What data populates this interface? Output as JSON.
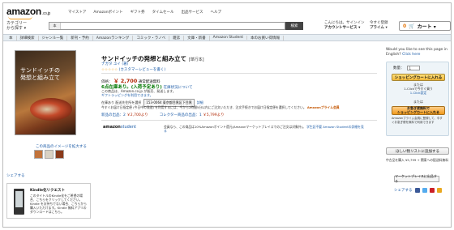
{
  "header": {
    "logo_main": "amazon",
    "logo_suffix": ".co.jp",
    "top_links": [
      "マイストア",
      "Amazonポイント",
      "ギフト券",
      "タイムセール",
      "出品サービス",
      "ヘルプ"
    ],
    "category_label": "カテゴリー\nから探す ▾",
    "search_category": "本",
    "search_value": "",
    "search_button": "検索",
    "account_line1": "こんにちは。サインイン",
    "account_line2": "アカウントサービス ▾",
    "prime_line1": "今すぐ登録",
    "prime_line2": "プライム ▾",
    "cart_count": "0",
    "cart_label": "カート ▾"
  },
  "catbar": [
    "本",
    "詳細検索",
    "ジャンル一覧",
    "新刊・予約",
    "Amazonランキング",
    "コミック・ラノベ",
    "雑誌",
    "文庫・新書",
    "Amazon Student",
    "本のお買い得情報"
  ],
  "product": {
    "cover_title": "サンドイッチの\n発想と組み立て",
    "title": "サンドイッチの発想と組み立て",
    "format": "[単行本]",
    "author": "ナガタ ユイ (著)",
    "stars": "☆☆☆☆☆",
    "reviews": "(カスタマーレビューを書く)",
    "price_label": "価格：",
    "price": "￥ 2,700",
    "price_note": "通常配送無料",
    "stock": "6点在庫あり。(入荷予定あり)",
    "stock_note": "在庫状況について",
    "seller": "この商品は、Amazon.co.jp が販売、発送します。",
    "gift": "ギフトラッピングを利用できます。",
    "delivery_label": "在庫あり 配送先住所を選択",
    "delivery_value": "153-0064 東京都目黒区下目黒",
    "delivery_link": "詳細",
    "info": "今すぐお届け日指定便 (今日中の発送) を利用するには、今から2時間5分以内にご注文いただき、注文手続きでお届け日指定便を選択してください。",
    "info_bold": "Amazonプライム会員",
    "new_label": "新品の出品：2",
    "new_price": "￥2,700より",
    "used_label": "コレクター商品の出品：1",
    "used_price": "￥5,799より"
  },
  "student": {
    "logo_a": "amazon",
    "logo_b": "student",
    "text": "会員なら、この商品は10%Amazonポイント還元(Amazonマーケットプレイスでのご注文は対象外)。",
    "link": "学生証不要 Amazon Studentの詳細を見る"
  },
  "left": {
    "zoom_link": "この商品のイメージを拡大する",
    "share": "シェアする",
    "kindle_title": "Kindle化リクエスト",
    "kindle_desc": "このタイトルのKindle化をご希望の場合、こちらをクリックしてください。Kindle をお持ちでない場合、こちらから購入いただけます。Kindle 無料アプリのダウンロードはこちら。"
  },
  "side": {
    "question": "Would you like to see this page in English?",
    "question_link": "Click here",
    "qty_label": "数量：",
    "qty_value": "1",
    "add_cart": "ショッピングカートに入れる",
    "or1": "または",
    "oneclick": "1-Clickで今すぐ買う",
    "oneclick_link": "1-Click設定",
    "or2": "または",
    "prime_btn": "お急ぎ便無料で\nショッピングカートに入れる",
    "prime_note": "Amazonプライム会員に登録して、今すぐお急ぎ便を無料で利用できます",
    "wishlist": "ほしい物リストに追加する",
    "points": "中古品を購入 ¥5,799 + 関東への配送料無料",
    "points_link": "マーケットプレイスに出品する",
    "sell_button": "マーケットプレイスに出品する",
    "sns_label": "シェアする"
  }
}
